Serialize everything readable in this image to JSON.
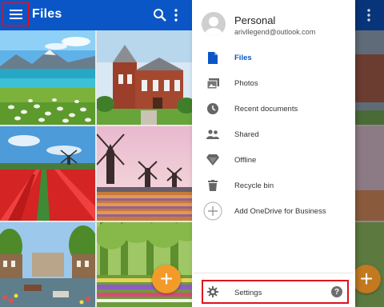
{
  "left": {
    "app_title": "Files",
    "fab_label": "+"
  },
  "drawer": {
    "account_name": "Personal",
    "account_email": "arivllegend@outlook.com",
    "items": [
      {
        "label": "Files",
        "icon": "file-icon",
        "active": true
      },
      {
        "label": "Photos",
        "icon": "photos-icon",
        "active": false
      },
      {
        "label": "Recent documents",
        "icon": "clock-icon",
        "active": false
      },
      {
        "label": "Shared",
        "icon": "people-icon",
        "active": false
      },
      {
        "label": "Offline",
        "icon": "diamond-icon",
        "active": false
      },
      {
        "label": "Recycle bin",
        "icon": "trash-icon",
        "active": false
      },
      {
        "label": "Add OneDrive for Business",
        "icon": "plus-circle-icon",
        "active": false
      }
    ],
    "settings_label": "Settings",
    "help_label": "?"
  },
  "right_fab_label": "+",
  "colors": {
    "appbar": "#0a56c7",
    "accent_orange": "#f39b28",
    "highlight_red": "#e0101a",
    "active_blue": "#0a56c7"
  }
}
